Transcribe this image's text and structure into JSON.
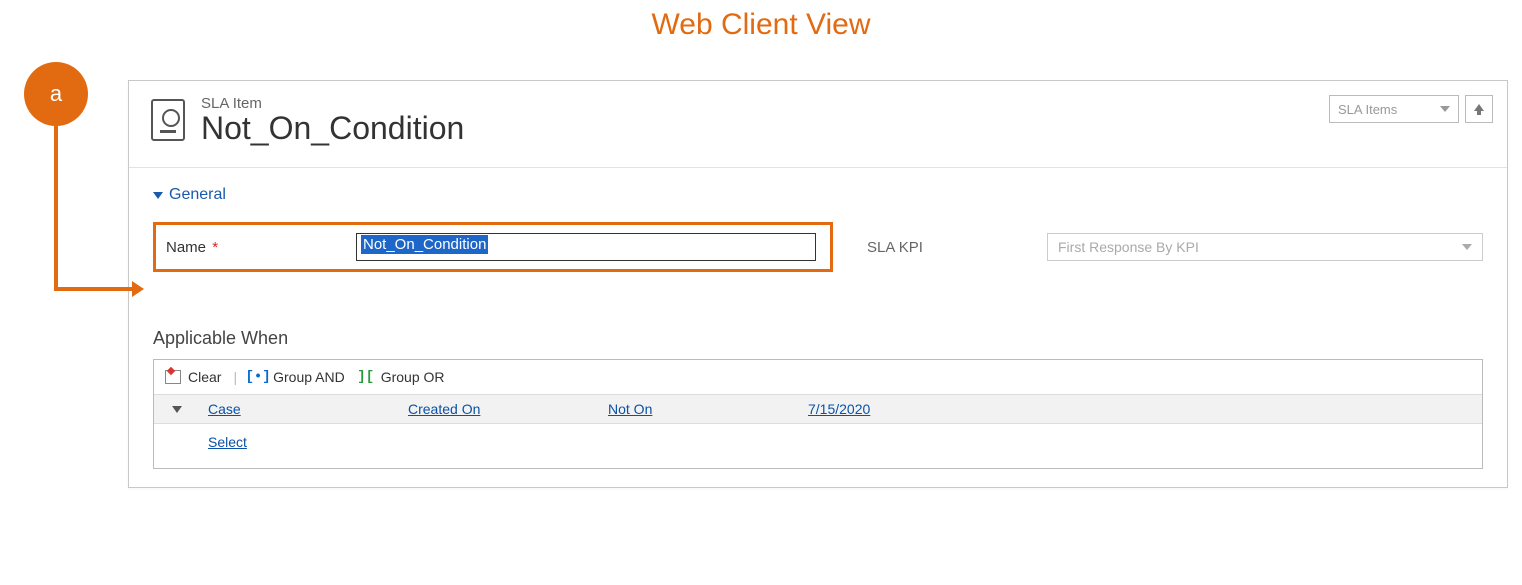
{
  "view_title": "Web Client View",
  "annotation_badge": "a",
  "header": {
    "entity_label": "SLA Item",
    "entity_title": "Not_On_Condition",
    "view_switcher_label": "SLA Items"
  },
  "section_general_label": "General",
  "fields": {
    "name_label": "Name",
    "name_required_mark": "*",
    "name_value": "Not_On_Condition",
    "slakpi_label": "SLA KPI",
    "slakpi_value": "First Response By KPI"
  },
  "applicable_when": {
    "heading": "Applicable When",
    "toolbar": {
      "clear": "Clear",
      "group_and": "Group AND",
      "group_or": "Group OR"
    },
    "condition": {
      "entity": "Case",
      "field": "Created On",
      "operator": "Not On",
      "value": "7/15/2020"
    },
    "select_label": "Select"
  }
}
